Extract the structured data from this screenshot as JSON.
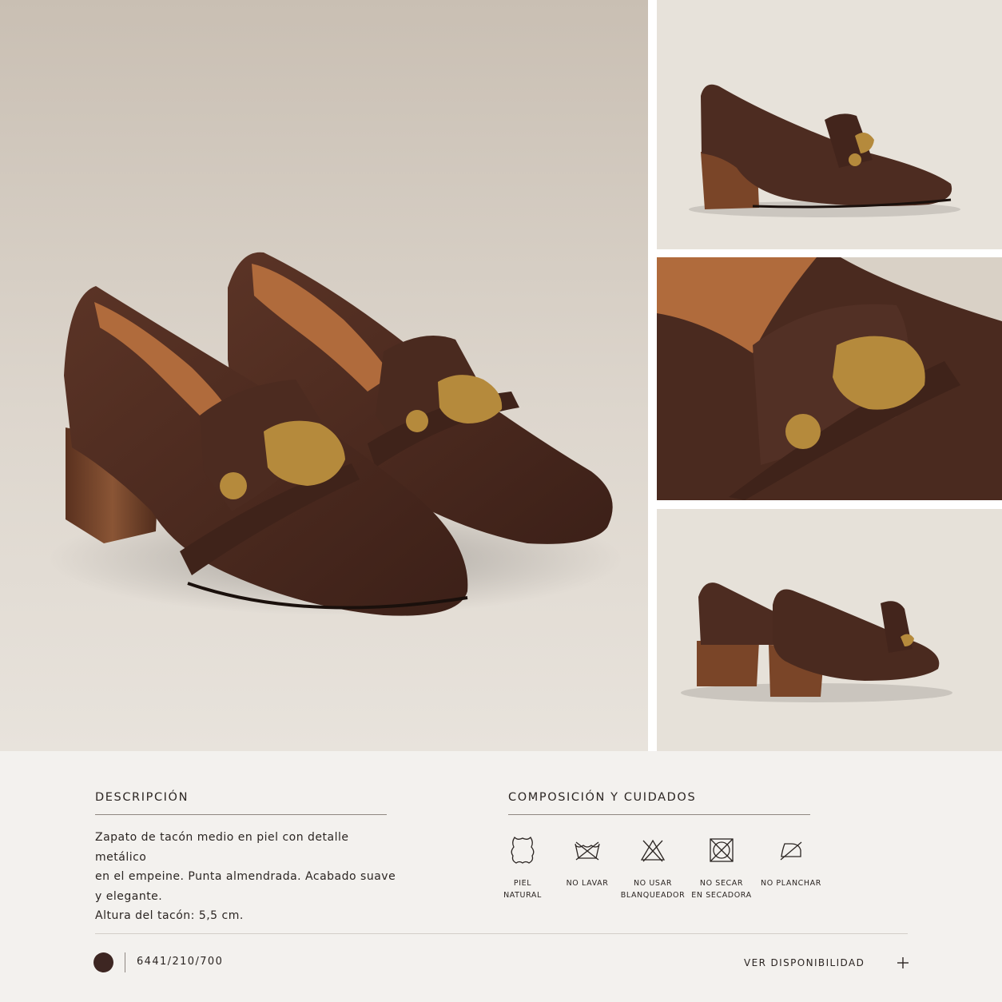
{
  "description": {
    "title": "DESCRIPCIÓN",
    "lines": [
      "Zapato de tacón medio en piel con detalle metálico",
      "en el empeine. Punta almendrada. Acabado suave",
      "y elegante.",
      "Altura del tacón: 5,5 cm."
    ]
  },
  "composition": {
    "title": "COMPOSICIÓN Y CUIDADOS",
    "care": [
      {
        "icon": "leather-hide-icon",
        "label": "PIEL\nNATURAL"
      },
      {
        "icon": "do-not-wash-icon",
        "label": "NO LAVAR"
      },
      {
        "icon": "do-not-bleach-icon",
        "label": "NO USAR\nBLANQUEADOR"
      },
      {
        "icon": "do-not-tumble-dry-icon",
        "label": "NO SECAR\nEN SECADORA"
      },
      {
        "icon": "do-not-iron-icon",
        "label": "NO PLANCHAR"
      }
    ]
  },
  "footer": {
    "color_swatch": "#3d2622",
    "reference": "6441/210/700",
    "availability_label": "VER DISPONIBILIDAD",
    "plus_icon": "plus-icon"
  },
  "colors": {
    "leather": "#4a2a1f",
    "heel": "#6e3f27",
    "hardware": "#b58a3c",
    "background": "#f3f1ee"
  }
}
